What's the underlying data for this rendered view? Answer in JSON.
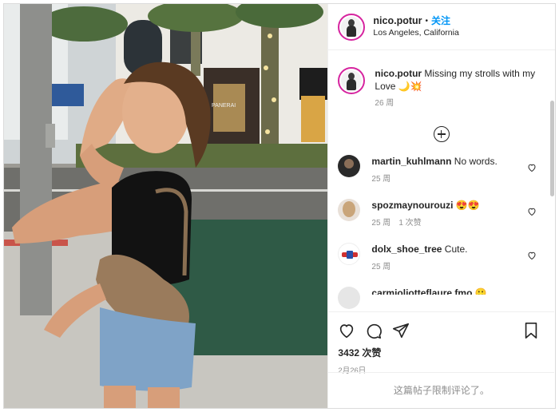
{
  "post": {
    "username": "nico.potur",
    "separator": "•",
    "follow_label": "关注",
    "location": "Los Angeles, California",
    "caption_text": "Missing my strolls with my Love 🌙💥",
    "caption_time": "26 周",
    "photo_sign_text": "PANERAI"
  },
  "comments": [
    {
      "username": "martin_kuhlmann",
      "text": "No words.",
      "time": "25 周",
      "likes": ""
    },
    {
      "username": "spozmaynourouzi",
      "text": "😍😍",
      "time": "25 周",
      "likes": "1 次赞"
    },
    {
      "username": "dolx_shoe_tree",
      "text": "Cute.",
      "time": "25 周",
      "likes": ""
    },
    {
      "username": "carmjoliotteflaure fmo",
      "text": "🙂",
      "time": "",
      "likes": ""
    }
  ],
  "actions": {
    "likes_count": "3432 次赞",
    "date": "2月26日",
    "comments_restricted": "这篇帖子限制评论了。"
  },
  "icons": [
    "heart-icon",
    "comment-icon",
    "share-icon",
    "bookmark-icon",
    "add-circle-icon"
  ],
  "colors": {
    "follow_blue": "#0095f6",
    "muted_gray": "#8e8e8e",
    "ring": "#d6249f"
  }
}
